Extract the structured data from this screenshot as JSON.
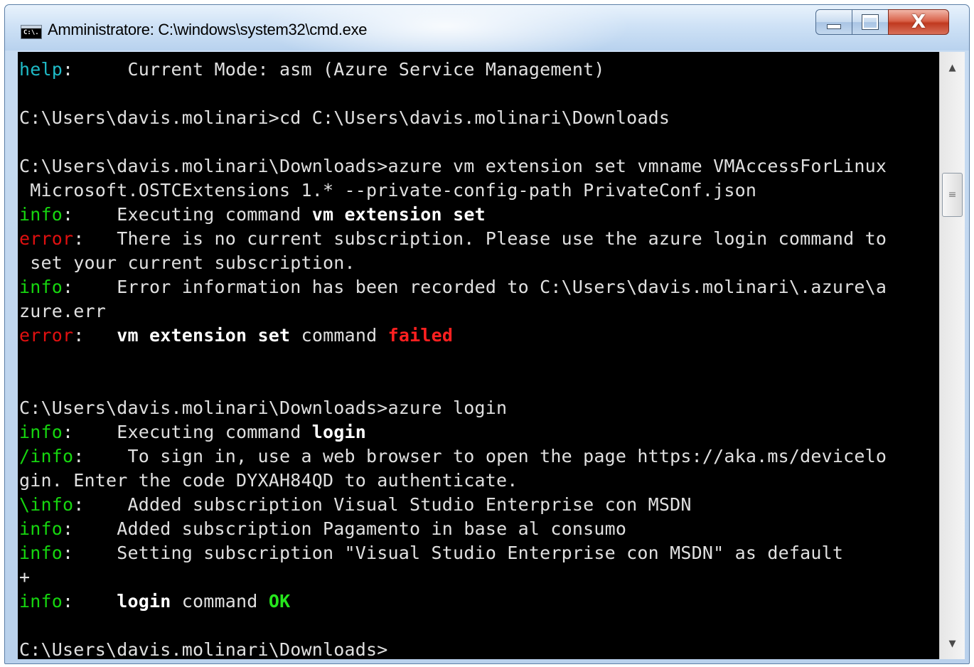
{
  "window": {
    "title": "Amministratore: C:\\windows\\system32\\cmd.exe",
    "icon": "cmd-icon",
    "icon_text": "C:\\.",
    "controls": {
      "minimize": "minimize-icon",
      "maximize": "maximize-icon",
      "close": "close-icon"
    },
    "close_glyph": "X"
  },
  "colors": {
    "help": "#1fbbc7",
    "info": "#16d60f",
    "error": "#e01010",
    "failed": "#ff2020",
    "ok": "#26e61d",
    "text": "#e0e0e0",
    "background": "#000000"
  },
  "console": {
    "lines": [
      [
        {
          "t": "help",
          "c": "help"
        },
        {
          "t": ":     Current Mode: asm (Azure Service Management)"
        }
      ],
      [],
      [
        {
          "t": "C:\\Users\\davis.molinari>cd C:\\Users\\davis.molinari\\Downloads"
        }
      ],
      [],
      [
        {
          "t": "C:\\Users\\davis.molinari\\Downloads>azure vm extension set vmname VMAccessForLinux"
        }
      ],
      [
        {
          "t": " Microsoft.OSTCExtensions 1.* --private-config-path PrivateConf.json"
        }
      ],
      [
        {
          "t": "info",
          "c": "info"
        },
        {
          "t": ":    Executing command "
        },
        {
          "t": "vm extension set",
          "c": "bold"
        }
      ],
      [
        {
          "t": "error",
          "c": "error"
        },
        {
          "t": ":   There is no current subscription. Please use the azure login command to"
        }
      ],
      [
        {
          "t": " set your current subscription."
        }
      ],
      [
        {
          "t": "info",
          "c": "info"
        },
        {
          "t": ":    Error information has been recorded to C:\\Users\\davis.molinari\\.azure\\a"
        }
      ],
      [
        {
          "t": "zure.err"
        }
      ],
      [
        {
          "t": "error",
          "c": "error"
        },
        {
          "t": ":   "
        },
        {
          "t": "vm extension set",
          "c": "bold"
        },
        {
          "t": " command "
        },
        {
          "t": "failed",
          "c": "fail"
        }
      ],
      [],
      [],
      [
        {
          "t": "C:\\Users\\davis.molinari\\Downloads>azure login"
        }
      ],
      [
        {
          "t": "info",
          "c": "info"
        },
        {
          "t": ":    Executing command "
        },
        {
          "t": "login",
          "c": "bold"
        }
      ],
      [
        {
          "t": "/info",
          "c": "info"
        },
        {
          "t": ":    To sign in, use a web browser to open the page https://aka.ms/devicelo"
        }
      ],
      [
        {
          "t": "gin. Enter the code DYXAH84QD to authenticate."
        }
      ],
      [
        {
          "t": "\\info",
          "c": "info"
        },
        {
          "t": ":    Added subscription Visual Studio Enterprise con MSDN"
        }
      ],
      [
        {
          "t": "info",
          "c": "info"
        },
        {
          "t": ":    Added subscription Pagamento in base al consumo"
        }
      ],
      [
        {
          "t": "info",
          "c": "info"
        },
        {
          "t": ":    Setting subscription \"Visual Studio Enterprise con MSDN\" as default"
        }
      ],
      [
        {
          "t": "+"
        }
      ],
      [
        {
          "t": "info",
          "c": "info"
        },
        {
          "t": ":    "
        },
        {
          "t": "login",
          "c": "bold"
        },
        {
          "t": " command "
        },
        {
          "t": "OK",
          "c": "ok"
        }
      ],
      [],
      [
        {
          "t": "C:\\Users\\davis.molinari\\Downloads>"
        }
      ]
    ]
  },
  "scrollbar": {
    "up_icon": "scroll-up-arrow-icon",
    "down_icon": "scroll-down-arrow-icon",
    "thumb_grip": "≡",
    "up_glyph": "▲",
    "down_glyph": "▼"
  }
}
